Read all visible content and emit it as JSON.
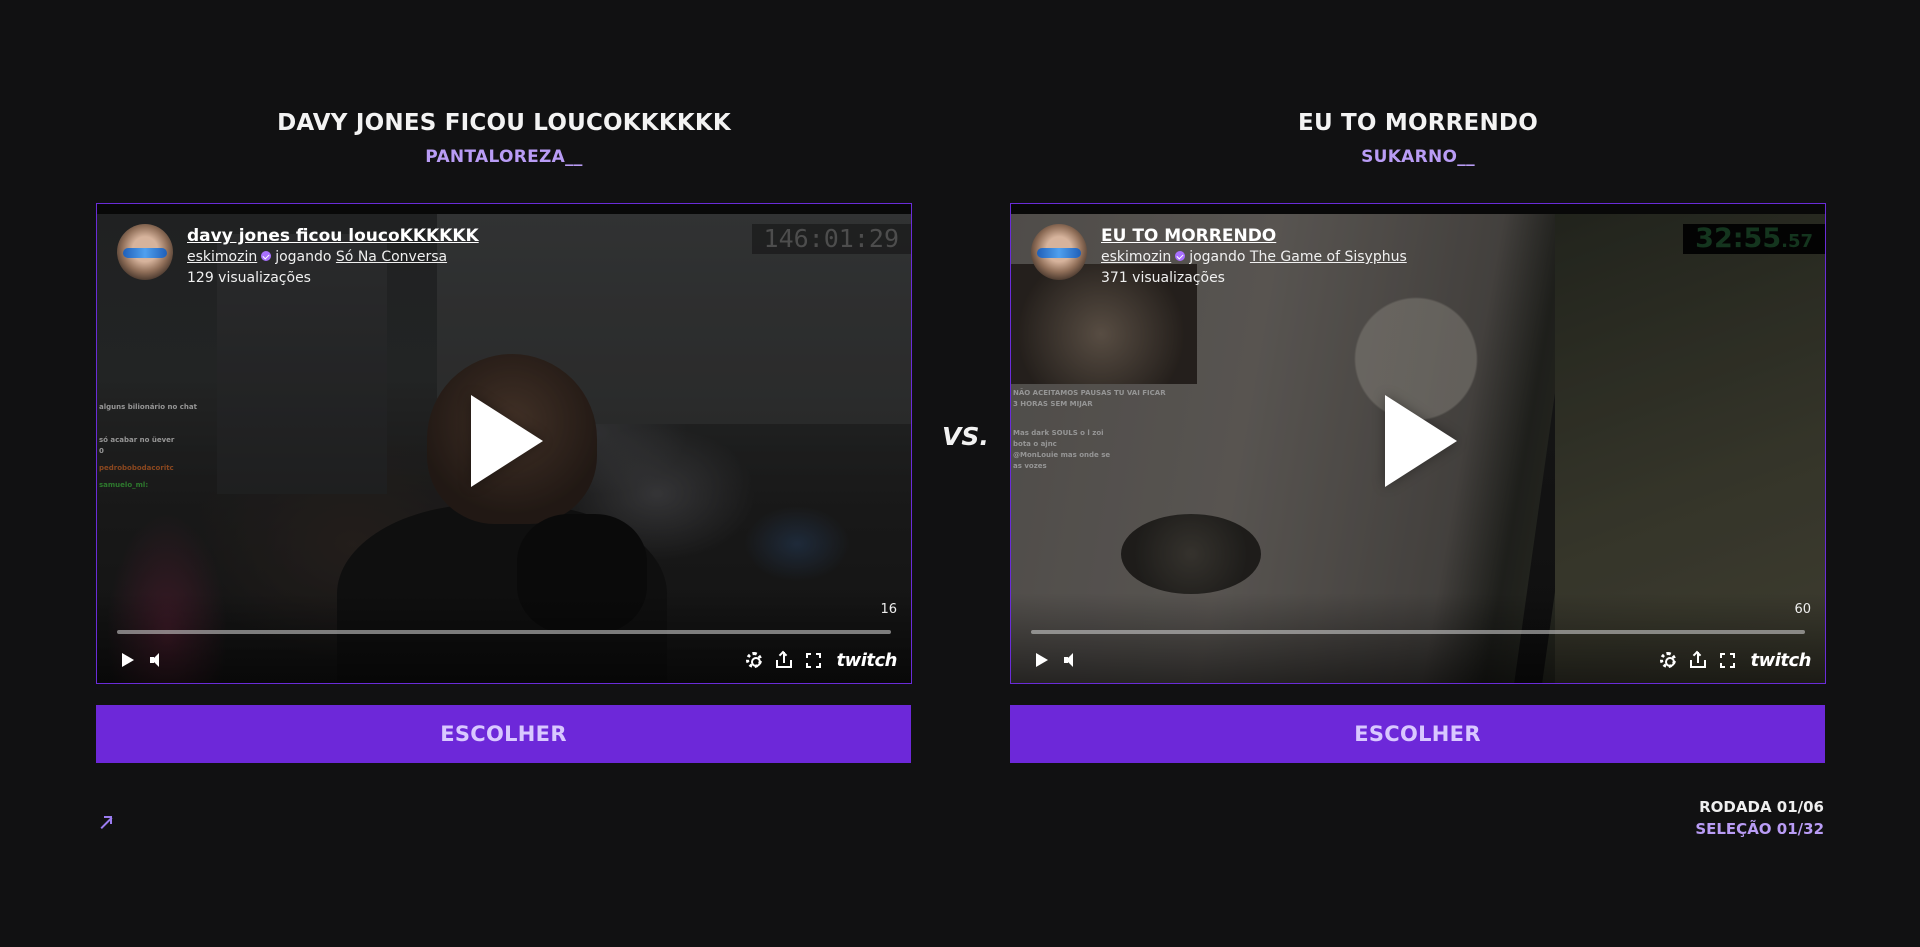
{
  "vs_label": "VS.",
  "clips": [
    {
      "heading": "DAVY JONES FICOU LOUCOKKKKKK",
      "author": "PANTALOREZA__",
      "player": {
        "title": "davy jones ficou loucoKKKKKK",
        "channel": "eskimozin",
        "playing_word": "jogando",
        "game": "Só Na Conversa",
        "views": "129 visualizações",
        "timer": "146:01:29",
        "viewer_count": "16",
        "chat": [
          "alguns bilionário no chat",
          "só acabar no üever",
          "0",
          "pedrobobodacoritc",
          "samuelo_ml:"
        ]
      },
      "choose_label": "ESCOLHER"
    },
    {
      "heading": "EU TO MORRENDO",
      "author": "SUKARNO__",
      "player": {
        "title": "EU TO MORRENDO",
        "channel": "eskimozin",
        "playing_word": "jogando",
        "game": "The Game of Sisyphus",
        "views": "371 visualizações",
        "timer": "32:55",
        "timer_small": ".57",
        "viewer_count": "60",
        "chat": [
          "NÃO ACEITAMOS PAUSAS TU VAI FICAR",
          "3 HORAS SEM MIJAR",
          "Mas dark SOULS o l zoi",
          "bota o ajnc",
          "@MonLouie mas onde se",
          "as vozes"
        ]
      },
      "choose_label": "ESCOLHER"
    }
  ],
  "progress": {
    "round": "RODADA 01/06",
    "selection": "SELEÇÃO 01/32"
  },
  "icons": {
    "play": "play-icon",
    "volume": "volume-icon",
    "settings": "gear-icon",
    "share": "share-icon",
    "fullscreen": "fullscreen-icon",
    "brand": "twitch"
  },
  "colors": {
    "background": "#111112",
    "accent": "#6d28d9",
    "accent_text": "#b99cf5"
  }
}
